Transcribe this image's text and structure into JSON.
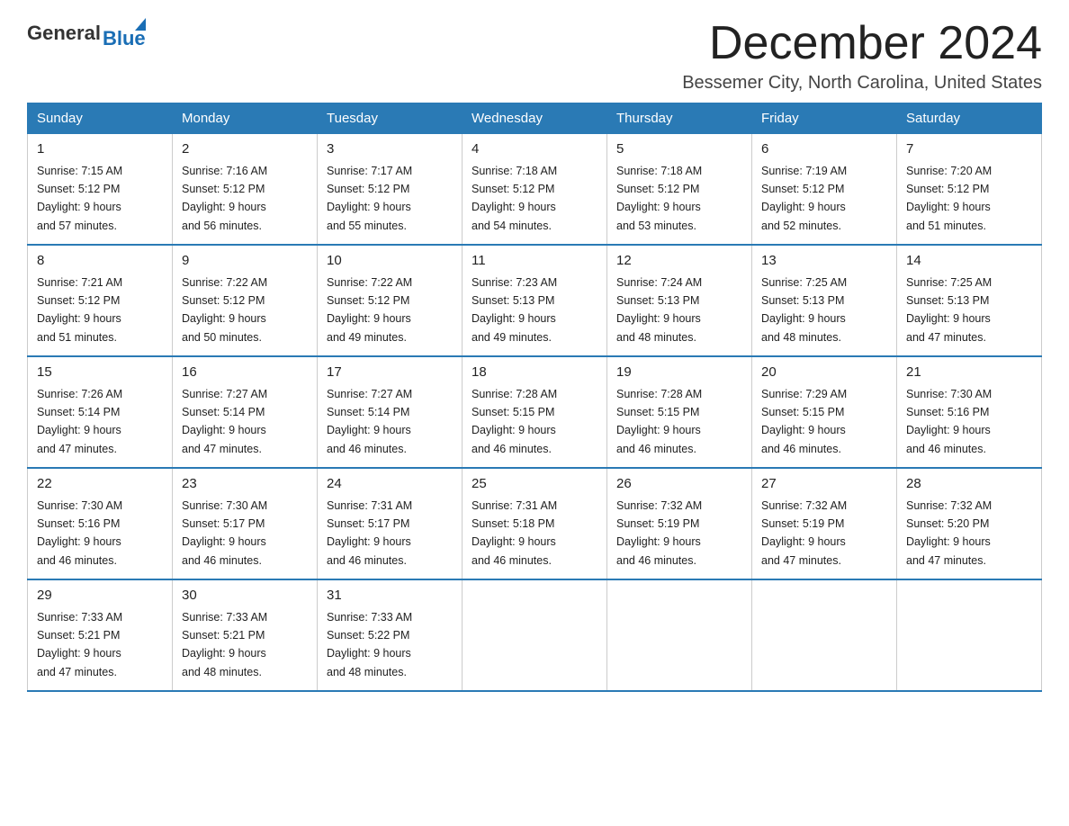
{
  "logo": {
    "general": "General",
    "blue": "Blue"
  },
  "title": "December 2024",
  "location": "Bessemer City, North Carolina, United States",
  "days_of_week": [
    "Sunday",
    "Monday",
    "Tuesday",
    "Wednesday",
    "Thursday",
    "Friday",
    "Saturday"
  ],
  "weeks": [
    [
      {
        "day": "1",
        "sunrise": "7:15 AM",
        "sunset": "5:12 PM",
        "daylight": "9 hours and 57 minutes."
      },
      {
        "day": "2",
        "sunrise": "7:16 AM",
        "sunset": "5:12 PM",
        "daylight": "9 hours and 56 minutes."
      },
      {
        "day": "3",
        "sunrise": "7:17 AM",
        "sunset": "5:12 PM",
        "daylight": "9 hours and 55 minutes."
      },
      {
        "day": "4",
        "sunrise": "7:18 AM",
        "sunset": "5:12 PM",
        "daylight": "9 hours and 54 minutes."
      },
      {
        "day": "5",
        "sunrise": "7:18 AM",
        "sunset": "5:12 PM",
        "daylight": "9 hours and 53 minutes."
      },
      {
        "day": "6",
        "sunrise": "7:19 AM",
        "sunset": "5:12 PM",
        "daylight": "9 hours and 52 minutes."
      },
      {
        "day": "7",
        "sunrise": "7:20 AM",
        "sunset": "5:12 PM",
        "daylight": "9 hours and 51 minutes."
      }
    ],
    [
      {
        "day": "8",
        "sunrise": "7:21 AM",
        "sunset": "5:12 PM",
        "daylight": "9 hours and 51 minutes."
      },
      {
        "day": "9",
        "sunrise": "7:22 AM",
        "sunset": "5:12 PM",
        "daylight": "9 hours and 50 minutes."
      },
      {
        "day": "10",
        "sunrise": "7:22 AM",
        "sunset": "5:12 PM",
        "daylight": "9 hours and 49 minutes."
      },
      {
        "day": "11",
        "sunrise": "7:23 AM",
        "sunset": "5:13 PM",
        "daylight": "9 hours and 49 minutes."
      },
      {
        "day": "12",
        "sunrise": "7:24 AM",
        "sunset": "5:13 PM",
        "daylight": "9 hours and 48 minutes."
      },
      {
        "day": "13",
        "sunrise": "7:25 AM",
        "sunset": "5:13 PM",
        "daylight": "9 hours and 48 minutes."
      },
      {
        "day": "14",
        "sunrise": "7:25 AM",
        "sunset": "5:13 PM",
        "daylight": "9 hours and 47 minutes."
      }
    ],
    [
      {
        "day": "15",
        "sunrise": "7:26 AM",
        "sunset": "5:14 PM",
        "daylight": "9 hours and 47 minutes."
      },
      {
        "day": "16",
        "sunrise": "7:27 AM",
        "sunset": "5:14 PM",
        "daylight": "9 hours and 47 minutes."
      },
      {
        "day": "17",
        "sunrise": "7:27 AM",
        "sunset": "5:14 PM",
        "daylight": "9 hours and 46 minutes."
      },
      {
        "day": "18",
        "sunrise": "7:28 AM",
        "sunset": "5:15 PM",
        "daylight": "9 hours and 46 minutes."
      },
      {
        "day": "19",
        "sunrise": "7:28 AM",
        "sunset": "5:15 PM",
        "daylight": "9 hours and 46 minutes."
      },
      {
        "day": "20",
        "sunrise": "7:29 AM",
        "sunset": "5:15 PM",
        "daylight": "9 hours and 46 minutes."
      },
      {
        "day": "21",
        "sunrise": "7:30 AM",
        "sunset": "5:16 PM",
        "daylight": "9 hours and 46 minutes."
      }
    ],
    [
      {
        "day": "22",
        "sunrise": "7:30 AM",
        "sunset": "5:16 PM",
        "daylight": "9 hours and 46 minutes."
      },
      {
        "day": "23",
        "sunrise": "7:30 AM",
        "sunset": "5:17 PM",
        "daylight": "9 hours and 46 minutes."
      },
      {
        "day": "24",
        "sunrise": "7:31 AM",
        "sunset": "5:17 PM",
        "daylight": "9 hours and 46 minutes."
      },
      {
        "day": "25",
        "sunrise": "7:31 AM",
        "sunset": "5:18 PM",
        "daylight": "9 hours and 46 minutes."
      },
      {
        "day": "26",
        "sunrise": "7:32 AM",
        "sunset": "5:19 PM",
        "daylight": "9 hours and 46 minutes."
      },
      {
        "day": "27",
        "sunrise": "7:32 AM",
        "sunset": "5:19 PM",
        "daylight": "9 hours and 47 minutes."
      },
      {
        "day": "28",
        "sunrise": "7:32 AM",
        "sunset": "5:20 PM",
        "daylight": "9 hours and 47 minutes."
      }
    ],
    [
      {
        "day": "29",
        "sunrise": "7:33 AM",
        "sunset": "5:21 PM",
        "daylight": "9 hours and 47 minutes."
      },
      {
        "day": "30",
        "sunrise": "7:33 AM",
        "sunset": "5:21 PM",
        "daylight": "9 hours and 48 minutes."
      },
      {
        "day": "31",
        "sunrise": "7:33 AM",
        "sunset": "5:22 PM",
        "daylight": "9 hours and 48 minutes."
      },
      null,
      null,
      null,
      null
    ]
  ],
  "labels": {
    "sunrise": "Sunrise:",
    "sunset": "Sunset:",
    "daylight": "Daylight:"
  }
}
